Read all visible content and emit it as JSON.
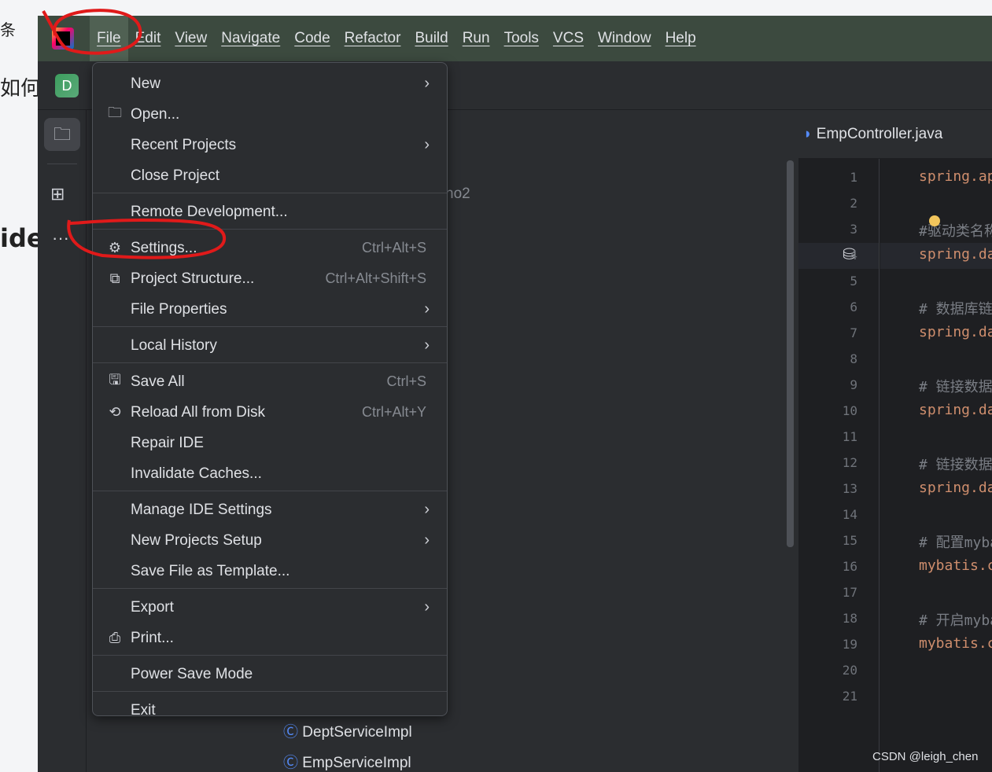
{
  "browser": {
    "frag1": "条",
    "frag2": "如何i",
    "frag3": "ide"
  },
  "menubar": [
    "File",
    "Edit",
    "View",
    "Navigate",
    "Code",
    "Refactor",
    "Build",
    "Run",
    "Tools",
    "VCS",
    "Window",
    "Help"
  ],
  "project_badge": "D",
  "file_menu": {
    "groups": [
      [
        {
          "label": "New",
          "icon": "",
          "arrow": true
        },
        {
          "label": "Open...",
          "icon": "folder-icon"
        },
        {
          "label": "Recent Projects",
          "arrow": true
        },
        {
          "label": "Close Project"
        }
      ],
      [
        {
          "label": "Remote Development..."
        }
      ],
      [
        {
          "label": "Settings...",
          "icon": "gear-icon",
          "shortcut": "Ctrl+Alt+S"
        },
        {
          "label": "Project Structure...",
          "icon": "project-structure-icon",
          "shortcut": "Ctrl+Alt+Shift+S"
        },
        {
          "label": "File Properties",
          "arrow": true
        }
      ],
      [
        {
          "label": "Local History",
          "arrow": true
        }
      ],
      [
        {
          "label": "Save All",
          "icon": "save-icon",
          "shortcut": "Ctrl+S"
        },
        {
          "label": "Reload All from Disk",
          "icon": "reload-icon",
          "shortcut": "Ctrl+Alt+Y"
        },
        {
          "label": "Repair IDE"
        },
        {
          "label": "Invalidate Caches..."
        }
      ],
      [
        {
          "label": "Manage IDE Settings",
          "arrow": true
        },
        {
          "label": "New Projects Setup",
          "arrow": true
        },
        {
          "label": "Save File as Template..."
        }
      ],
      [
        {
          "label": "Export",
          "arrow": true
        },
        {
          "label": "Print...",
          "icon": "print-icon"
        }
      ],
      [
        {
          "label": "Power Save Mode"
        }
      ],
      [
        {
          "label": "Exit"
        }
      ]
    ]
  },
  "tree": {
    "partial_name": "no2",
    "item1": "DeptServiceImpl",
    "item2": "EmpServiceImpl"
  },
  "editor": {
    "tab": "EmpController.java",
    "lines": [
      {
        "n": "1",
        "t": "spring.appli",
        "k": "k"
      },
      {
        "n": "2",
        "t": ""
      },
      {
        "n": "3",
        "t": "#驱动类名称",
        "k": "c"
      },
      {
        "n": "4",
        "t": "spring.datas",
        "k": "k"
      },
      {
        "n": "5",
        "t": ""
      },
      {
        "n": "6",
        "t": "# 数据库链接UR",
        "k": "c"
      },
      {
        "n": "7",
        "t": "spring.datas",
        "k": "k"
      },
      {
        "n": "8",
        "t": ""
      },
      {
        "n": "9",
        "t": "# 链接数据库的",
        "k": "c"
      },
      {
        "n": "10",
        "t": "spring.datas",
        "k": "k"
      },
      {
        "n": "11",
        "t": ""
      },
      {
        "n": "12",
        "t": "# 链接数据库的",
        "k": "c"
      },
      {
        "n": "13",
        "t": "spring.datas",
        "k": "k"
      },
      {
        "n": "14",
        "t": ""
      },
      {
        "n": "15",
        "t": "# 配置mybatis",
        "k": "c"
      },
      {
        "n": "16",
        "t": "mybatis.conf",
        "k": "k"
      },
      {
        "n": "17",
        "t": ""
      },
      {
        "n": "18",
        "t": "# 开启mybatis",
        "k": "c"
      },
      {
        "n": "19",
        "t": "mybatis.conf",
        "k": "k"
      },
      {
        "n": "20",
        "t": ""
      },
      {
        "n": "21",
        "t": ""
      }
    ]
  },
  "watermark": "CSDN @leigh_chen",
  "colors": {
    "annotation": "#e01a1a",
    "accent": "#3574f0"
  }
}
